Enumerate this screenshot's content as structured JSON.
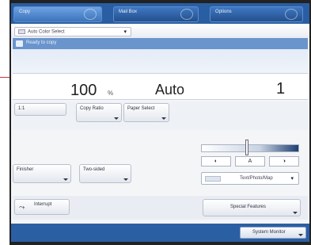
{
  "tabs": [
    {
      "label": "Copy",
      "active": true
    },
    {
      "label": "Mail Box",
      "active": false
    },
    {
      "label": "Options",
      "active": false
    }
  ],
  "color_mode": {
    "icon": "color-mode-icon",
    "label": "Auto Color Select"
  },
  "status": {
    "icon": "copier-icon",
    "text": "Ready to copy"
  },
  "values": {
    "ratio": "100",
    "ratio_unit": "%",
    "paper": "Auto",
    "copies": "1"
  },
  "buttons": {
    "one_to_one": "1:1",
    "copy_ratio": "Copy Ratio",
    "paper_select": "Paper Select",
    "finisher": "Finisher",
    "two_sided": "Two-sided",
    "interrupt": "Interrupt",
    "special_features": "Special Features",
    "system_monitor": "System Monitor"
  },
  "density": {
    "light_label": "◐",
    "auto_label": "A",
    "dark_label": "◑",
    "level": 0.5
  },
  "image_type": {
    "label": "Text/Photo/Map"
  },
  "colors": {
    "tab_blue": "#2a5ea2",
    "ready_band": "#6a94cc",
    "background": "#f4f5f7"
  }
}
